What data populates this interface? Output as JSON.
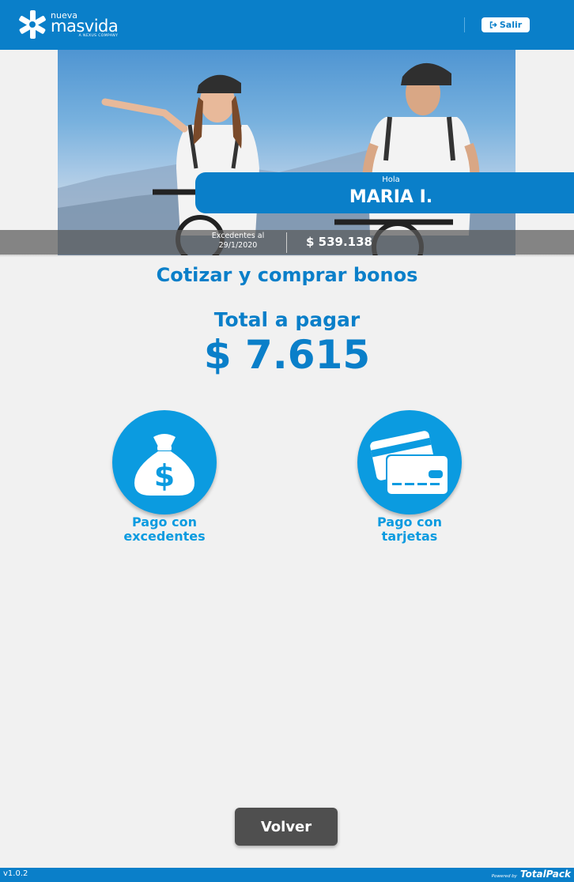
{
  "header": {
    "logo": {
      "top": "nueva",
      "name": "masvida",
      "tagline": "A NEXUS COMPANY"
    },
    "logout_label": "Salir",
    "logout_icon": "sign-out-icon",
    "brand_color": "#0a7fc9"
  },
  "hero": {
    "greeting": "Hola",
    "user_name": "MARIA I.",
    "balance_label_line1": "Excedentes al",
    "balance_label_line2": "29/1/2020",
    "balance_value": "$ 539.138"
  },
  "main": {
    "title": "Cotizar y comprar bonos",
    "total_label": "Total a pagar",
    "total_value": "$ 7.615",
    "payment_options": [
      {
        "label": "Pago con\nexcedentes",
        "icon": "money-bag-icon"
      },
      {
        "label": "Pago con\ntarjetas",
        "icon": "credit-cards-icon"
      }
    ],
    "accent_color": "#0b9be0"
  },
  "actions": {
    "back_label": "Volver"
  },
  "footer": {
    "version": "v1.0.2",
    "powered_by": "Powered by",
    "brand": "TotalPack"
  }
}
